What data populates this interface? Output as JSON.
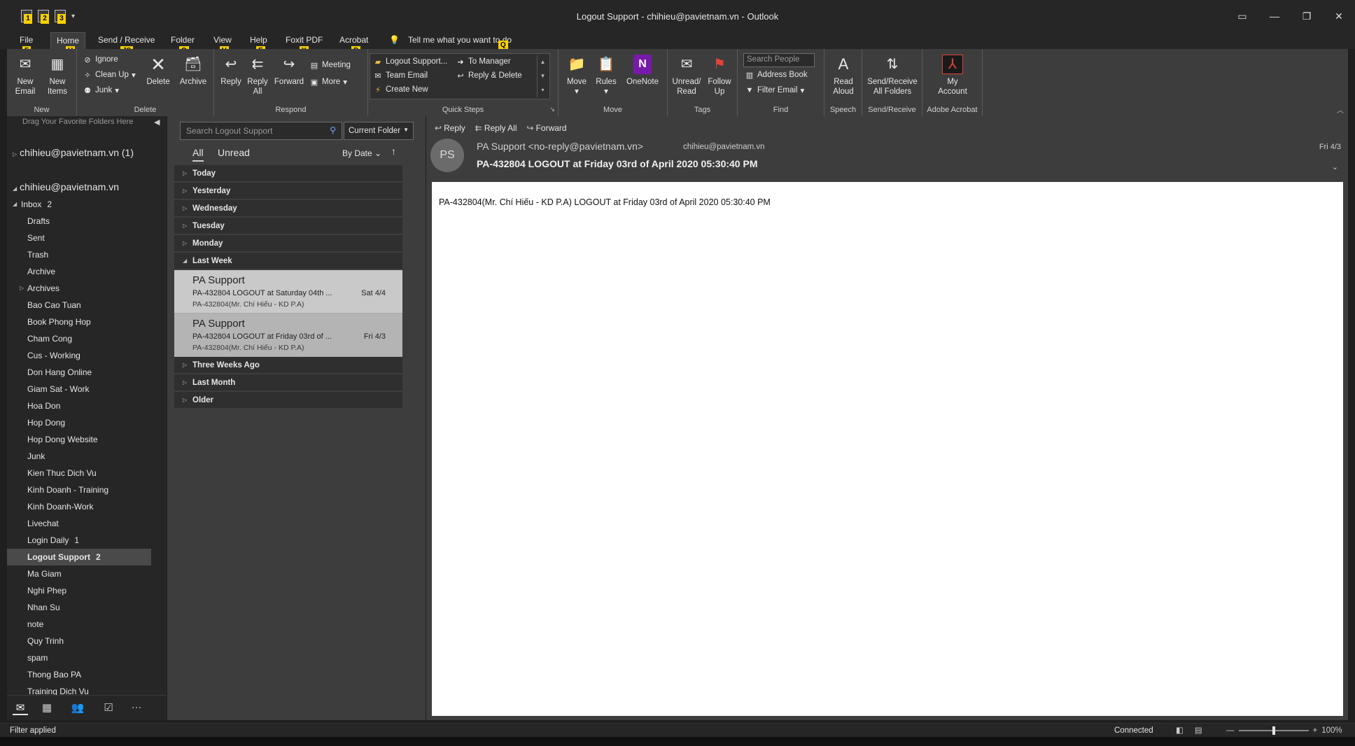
{
  "window": {
    "title": "Logout Support - chihieu@pavietnam.vn  -  Outlook",
    "qat_keytips": [
      "1",
      "2",
      "3"
    ]
  },
  "menu": {
    "tabs": [
      {
        "label": "File",
        "key": "F"
      },
      {
        "label": "Home",
        "key": "H"
      },
      {
        "label": "Send / Receive",
        "key": "JS"
      },
      {
        "label": "Folder",
        "key": "O"
      },
      {
        "label": "View",
        "key": "V"
      },
      {
        "label": "Help",
        "key": "E"
      },
      {
        "label": "Foxit PDF",
        "key": "Y"
      },
      {
        "label": "Acrobat",
        "key": "B"
      }
    ],
    "tellme": "Tell me what you want to do",
    "tellme_key": "Q"
  },
  "ribbon": {
    "new": {
      "label": "New",
      "new_email": "New\nEmail",
      "new_items": "New\nItems"
    },
    "delete": {
      "label": "Delete",
      "ignore": "Ignore",
      "cleanup": "Clean Up",
      "junk": "Junk",
      "delete": "Delete",
      "archive": "Archive"
    },
    "respond": {
      "label": "Respond",
      "reply": "Reply",
      "reply_all": "Reply\nAll",
      "forward": "Forward",
      "meeting": "Meeting",
      "more": "More"
    },
    "quicksteps": {
      "label": "Quick Steps",
      "items": [
        "Logout Support...",
        "Team Email",
        "Create New",
        "To Manager",
        "Reply & Delete"
      ]
    },
    "move": {
      "label": "Move",
      "move": "Move",
      "rules": "Rules",
      "onenote": "OneNote"
    },
    "tags": {
      "label": "Tags",
      "unread": "Unread/\nRead",
      "follow": "Follow\nUp"
    },
    "find": {
      "label": "Find",
      "search_placeholder": "Search People",
      "address_book": "Address Book",
      "filter_email": "Filter Email"
    },
    "speech": {
      "label": "Speech",
      "read_aloud": "Read\nAloud"
    },
    "sendreceive": {
      "label": "Send/Receive",
      "all": "Send/Receive\nAll Folders"
    },
    "acrobat": {
      "label": "Adobe Acrobat",
      "account": "My\nAccount"
    }
  },
  "folders": {
    "favorites_hint": "Drag Your Favorite Folders Here",
    "account1": "chihieu@pavietnam.vn (1)",
    "account2": "chihieu@pavietnam.vn",
    "inbox": {
      "label": "Inbox",
      "count": "2"
    },
    "list": [
      {
        "label": "Drafts",
        "count": ""
      },
      {
        "label": "Sent",
        "count": ""
      },
      {
        "label": "Trash",
        "count": ""
      },
      {
        "label": "Archive",
        "count": ""
      },
      {
        "label": "Archives",
        "count": ""
      },
      {
        "label": "Bao Cao Tuan",
        "count": ""
      },
      {
        "label": "Book Phong Hop",
        "count": ""
      },
      {
        "label": "Cham Cong",
        "count": ""
      },
      {
        "label": "Cus - Working",
        "count": ""
      },
      {
        "label": "Don Hang Online",
        "count": ""
      },
      {
        "label": "Giam Sat - Work",
        "count": ""
      },
      {
        "label": "Hoa Don",
        "count": ""
      },
      {
        "label": "Hop Dong",
        "count": ""
      },
      {
        "label": "Hop Dong Website",
        "count": ""
      },
      {
        "label": "Junk",
        "count": ""
      },
      {
        "label": "Kien Thuc Dich Vu",
        "count": ""
      },
      {
        "label": "Kinh Doanh - Training",
        "count": ""
      },
      {
        "label": "Kinh Doanh-Work",
        "count": ""
      },
      {
        "label": "Livechat",
        "count": ""
      },
      {
        "label": "Login Daily",
        "count": "1"
      },
      {
        "label": "Logout Support",
        "count": "2"
      },
      {
        "label": "Ma Giam",
        "count": ""
      },
      {
        "label": "Nghi Phep",
        "count": ""
      },
      {
        "label": "Nhan Su",
        "count": ""
      },
      {
        "label": "note",
        "count": ""
      },
      {
        "label": "Quy Trinh",
        "count": ""
      },
      {
        "label": "spam",
        "count": ""
      },
      {
        "label": "Thong Bao PA",
        "count": ""
      },
      {
        "label": "Training Dich Vu",
        "count": ""
      }
    ]
  },
  "list": {
    "search_placeholder": "Search Logout Support",
    "scope": "Current Folder",
    "filter_all": "All",
    "filter_unread": "Unread",
    "sort": "By Date",
    "groups_before": [
      "Today",
      "Yesterday",
      "Wednesday",
      "Tuesday",
      "Monday"
    ],
    "last_week": "Last Week",
    "messages": [
      {
        "from": "PA Support",
        "subject": "PA-432804 LOGOUT at Saturday 04th ...",
        "date": "Sat 4/4",
        "preview": "PA-432804(Mr. Chí Hiếu - KD P.A)"
      },
      {
        "from": "PA Support",
        "subject": "PA-432804 LOGOUT at Friday 03rd of ...",
        "date": "Fri 4/3",
        "preview": "PA-432804(Mr. Chí Hiếu - KD P.A)"
      }
    ],
    "groups_after": [
      "Three Weeks Ago",
      "Last Month",
      "Older"
    ]
  },
  "reading": {
    "reply": "Reply",
    "reply_all": "Reply All",
    "forward": "Forward",
    "avatar": "PS",
    "sender": "PA Support <no-reply@pavietnam.vn>",
    "recipient": "chihieu@pavietnam.vn",
    "date": "Fri 4/3",
    "subject": "PA-432804 LOGOUT at Friday 03rd of April 2020 05:30:40 PM",
    "body": "PA-432804(Mr. Chí Hiếu - KD P.A) LOGOUT at Friday 03rd of April 2020 05:30:40 PM"
  },
  "status": {
    "left": "Filter applied",
    "connection": "Connected",
    "zoom": "100%"
  }
}
